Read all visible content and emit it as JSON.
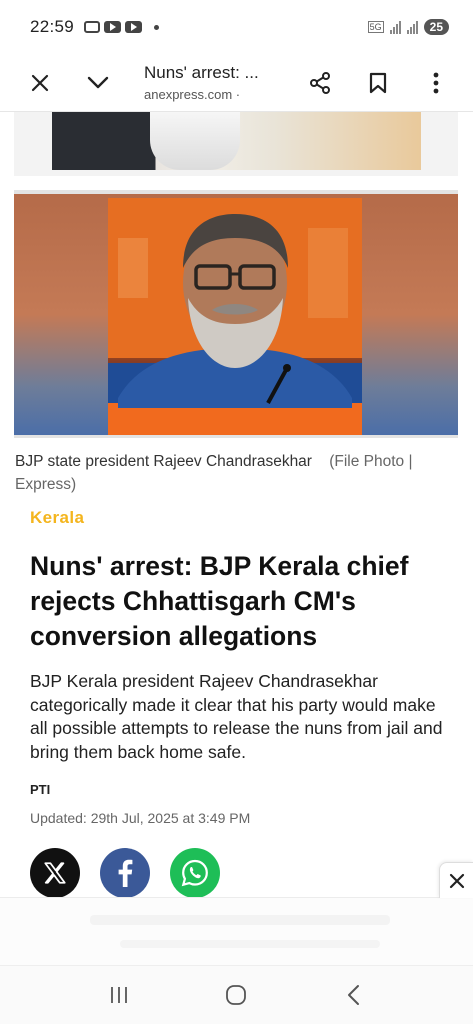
{
  "status_bar": {
    "time": "22:59",
    "network": "5G",
    "battery": "25"
  },
  "browser": {
    "title": "Nuns' arrest: ...",
    "url": "anexpress.com ·",
    "icons": [
      "close-icon",
      "chevron-down-icon",
      "share-icon",
      "bookmark-icon",
      "more-vert-icon"
    ]
  },
  "article": {
    "caption_text": "BJP state president Rajeev Chandrasekhar",
    "caption_credit": "(File Photo | Express)",
    "category": "Kerala",
    "headline": "Nuns' arrest: BJP Kerala chief rejects Chhattisgarh CM's conversion allegations",
    "summary": "BJP Kerala president Rajeev Chandrasekhar categorically made it clear that his party would make all possible attempts to release the nuns from jail and bring them back home safe.",
    "author": "PTI",
    "updated": "Updated: 29th Jul, 2025 at 3:49 PM"
  },
  "share": {
    "icons": [
      "x-icon",
      "facebook-icon",
      "whatsapp-icon"
    ],
    "colors": {
      "x": "#111111",
      "facebook": "#3b5998",
      "whatsapp": "#1ebe57"
    }
  },
  "colors": {
    "category": "#f4b51e"
  },
  "nav": {
    "icons": [
      "recent-apps-icon",
      "home-icon",
      "back-icon"
    ]
  }
}
